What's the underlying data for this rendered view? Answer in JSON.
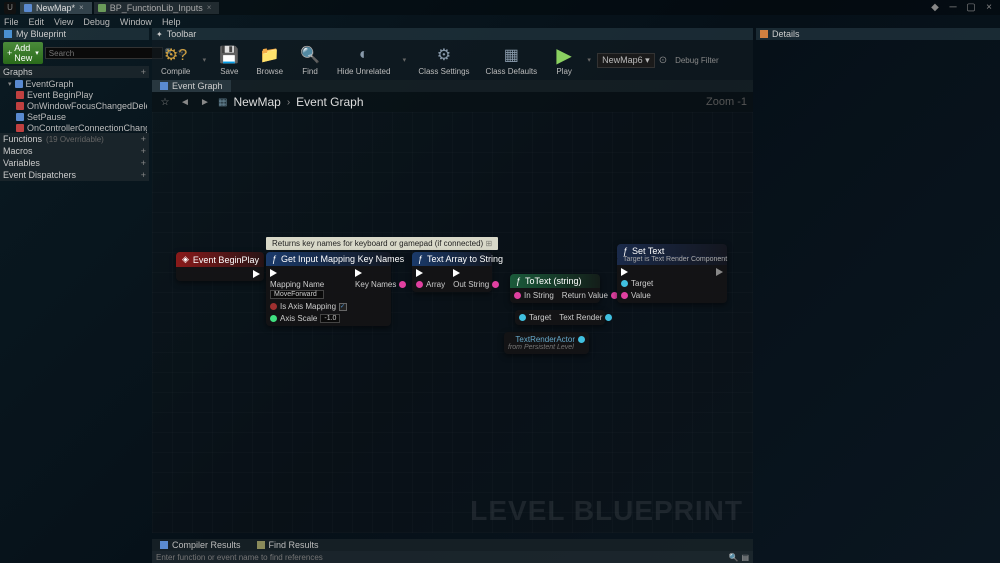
{
  "titlebar": {
    "tabs": [
      {
        "label": "NewMap*",
        "active": true
      },
      {
        "label": "BP_FunctionLib_Inputs",
        "active": false
      }
    ]
  },
  "menubar": [
    "File",
    "Edit",
    "View",
    "Debug",
    "Window",
    "Help"
  ],
  "myblueprint": {
    "title": "My Blueprint",
    "add_new": "Add New",
    "search_placeholder": "Search",
    "sections": {
      "graphs": {
        "label": "Graphs",
        "items": [
          {
            "label": "EventGraph",
            "type": "graph",
            "children": [
              {
                "label": "Event BeginPlay",
                "type": "event"
              },
              {
                "label": "OnWindowFocusChangedDelegate_Event",
                "type": "event"
              },
              {
                "label": "SetPause",
                "type": "func"
              },
              {
                "label": "OnControllerConnectionChangedDelegate",
                "type": "event"
              }
            ]
          }
        ]
      },
      "functions": {
        "label": "Functions",
        "sub": "(19 Overridable)"
      },
      "macros": {
        "label": "Macros"
      },
      "variables": {
        "label": "Variables"
      },
      "dispatchers": {
        "label": "Event Dispatchers"
      }
    }
  },
  "toolbar": {
    "title": "Toolbar",
    "buttons": {
      "compile": "Compile",
      "save": "Save",
      "browse": "Browse",
      "find": "Find",
      "hide": "Hide Unrelated",
      "settings": "Class Settings",
      "defaults": "Class Defaults",
      "play": "Play"
    },
    "debug_target": "NewMap6",
    "debug_filter": "Debug Filter"
  },
  "subtab": "Event Graph",
  "breadcrumb": {
    "map": "NewMap",
    "graph": "Event Graph",
    "zoom": "Zoom -1"
  },
  "tooltip": "Returns key names for keyboard or gamepad (if connected)",
  "nodes": {
    "beginplay": {
      "title": "Event BeginPlay"
    },
    "getmapping": {
      "title": "Get Input Mapping Key Names",
      "mapping_name_label": "Mapping Name",
      "mapping_name_value": "MoveForward",
      "axis_label": "Is Axis Mapping",
      "scale_label": "Axis Scale",
      "scale_value": "-1.0",
      "out_keynames": "Key Names"
    },
    "textarray": {
      "title": "Text Array to String",
      "in": "Array",
      "out": "Out String"
    },
    "totext": {
      "title": "ToText (string)",
      "in": "In String",
      "out": "Return Value"
    },
    "settext": {
      "title": "Set Text",
      "sub": "Target is Text Render Component",
      "target": "Target",
      "value": "Value"
    },
    "textrender": {
      "target": "Target",
      "out": "Text Render"
    },
    "actor": {
      "title": "TextRenderActor",
      "sub": "from Persistent Level"
    }
  },
  "watermark": "LEVEL BLUEPRINT",
  "bottom_tabs": {
    "compiler": "Compiler Results",
    "find": "Find Results"
  },
  "bottom_search_placeholder": "Enter function or event name to find references",
  "details": {
    "title": "Details"
  }
}
